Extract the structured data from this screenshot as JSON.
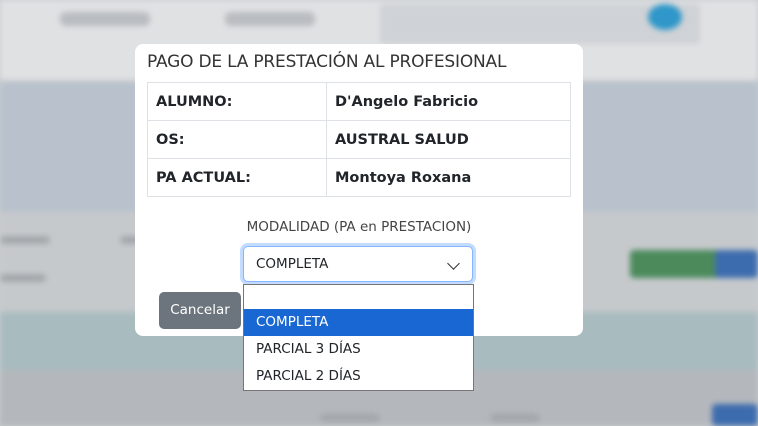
{
  "modal": {
    "title": "PAGO DE LA PRESTACIÓN AL PROFESIONAL",
    "rows": [
      {
        "label": "ALUMNO:",
        "value": "D'Angelo Fabricio"
      },
      {
        "label": "OS:",
        "value": "AUSTRAL SALUD"
      },
      {
        "label": "PA ACTUAL:",
        "value": "Montoya Roxana"
      }
    ],
    "modalidad_label": "MODALIDAD (PA en PRESTACION)",
    "select": {
      "value": "COMPLETA",
      "options": [
        "",
        "COMPLETA",
        "PARCIAL 3 DÍAS",
        "PARCIAL 2 DÍAS"
      ],
      "highlighted": "COMPLETA"
    },
    "cancel_label": "Cancelar"
  },
  "colors": {
    "highlight": "#1967d2",
    "cancel_button": "#6c757d",
    "focus_ring": "#86b7fe"
  }
}
